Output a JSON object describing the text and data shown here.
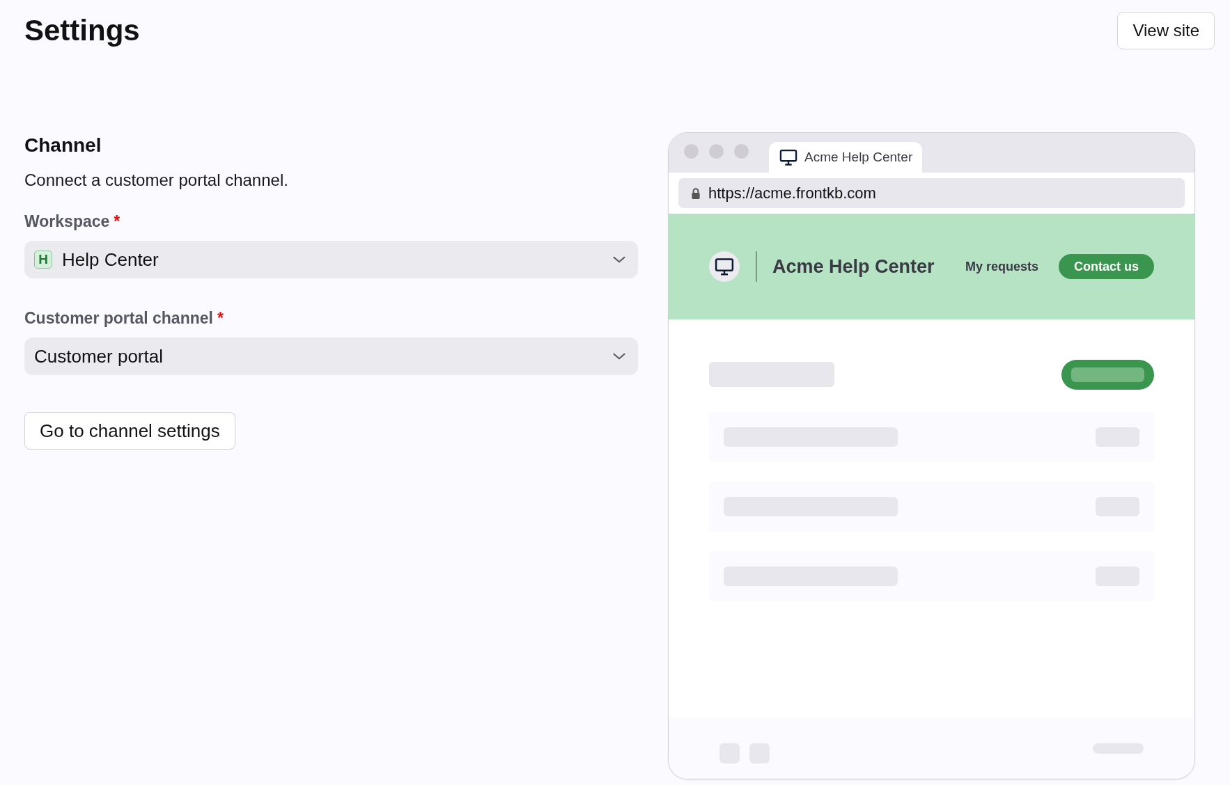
{
  "page": {
    "title": "Settings",
    "view_site": "View site"
  },
  "section": {
    "heading": "Channel",
    "description": "Connect a customer portal channel."
  },
  "fields": [
    {
      "label": "Workspace",
      "required_mark": "*",
      "badge": "H",
      "value": "Help Center"
    },
    {
      "label": "Customer portal channel",
      "required_mark": "*",
      "value": "Customer portal"
    }
  ],
  "action_button": "Go to channel settings",
  "preview": {
    "tab_title": "Acme Help Center",
    "url": "https://acme.frontkb.com",
    "site_name": "Acme Help Center",
    "nav_link": "My requests",
    "cta": "Contact us"
  }
}
